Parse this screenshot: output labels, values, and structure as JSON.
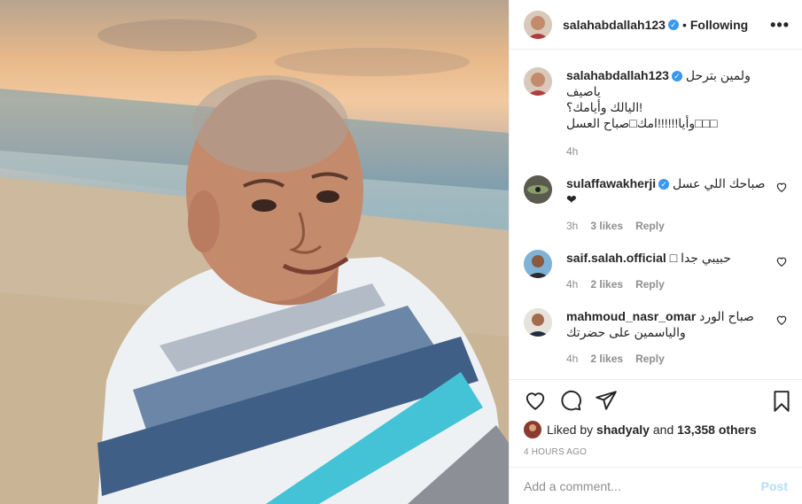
{
  "header": {
    "username": "salahabdallah123",
    "separator": "•",
    "follow_state": "Following",
    "more_icon": "more-horizontal-icon"
  },
  "caption": {
    "username": "salahabdallah123",
    "text_line1": "ولمين بترحل ياصيف",
    "text_line2": "!اليالك وأيامك؟",
    "text_line3": "□□□وأيا!!!!!!امك□صباح العسل",
    "time": "4h"
  },
  "comments": [
    {
      "username": "sulaffawakherji",
      "verified": true,
      "text_line1": "صباحك اللي عسل",
      "text_line2": "❤",
      "time": "3h",
      "likes": "3 likes",
      "reply": "Reply"
    },
    {
      "username": "saif.salah.official",
      "verified": false,
      "text_line1": "حبيبي جدا □",
      "text_line2": "",
      "time": "4h",
      "likes": "2 likes",
      "reply": "Reply"
    },
    {
      "username": "mahmoud_nasr_omar",
      "verified": false,
      "text_line1": "صباح الورد",
      "text_line2": "والياسمين على حضرتك",
      "time": "4h",
      "likes": "2 likes",
      "reply": "Reply"
    }
  ],
  "likes": {
    "prefix": "Liked by",
    "user": "shadyaly",
    "and": "and",
    "count": "13,358 others"
  },
  "timestamp": "4 HOURS AGO",
  "add_comment": {
    "placeholder": "Add a comment...",
    "post_label": "Post"
  },
  "colors": {
    "verified": "#3897f0",
    "post_disabled": "#b2dffc",
    "muted": "#8e8e8e"
  }
}
